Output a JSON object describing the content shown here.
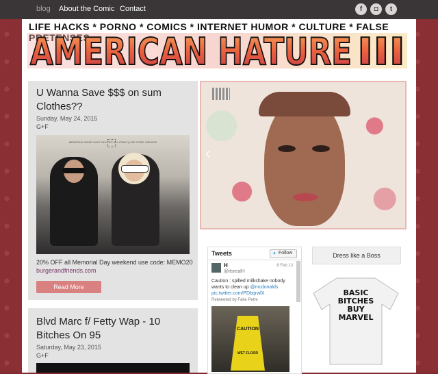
{
  "nav": {
    "blog": "blog",
    "about": "About the Comic",
    "contact": "Contact"
  },
  "social": {
    "facebook": "f",
    "instagram": "◘",
    "twitter": "t"
  },
  "header": {
    "tagline": "LIFE HACKS * PORNO * COMICS * INTERNET HUMOR * CULTURE * FALSE PRETENSES",
    "logo_text": "AMERICAN HATURE",
    "logo_suffix": "III"
  },
  "posts": [
    {
      "title_line1": "U Wanna Save $$$ on sum",
      "title_line2": "Clothes??",
      "date": "Sunday, May 24, 2015",
      "gplus": "G+F",
      "image_caption": "MEMORIAL WKND SALE 20% OFF ALL ITEMS | USE CODE: MEMO20",
      "body": "20% OFF all Memorial Day weekend use code: MEMO20",
      "link": "burgerandfriends.com",
      "readmore": "Read More"
    },
    {
      "title_line1": "Blvd Marc f/ Fetty Wap - 10",
      "title_line2": "Bitches On 95",
      "date": "Saturday, May 23, 2015",
      "gplus": "G+F"
    }
  ],
  "slider": {
    "prev": "‹"
  },
  "tweets": {
    "header": "Tweets",
    "follow": "Follow",
    "user": "H",
    "handle": "@itsrealH",
    "date": "8 Feb 13",
    "text_line1": "Caution : spilled milkshake nobody",
    "text_line2": "wants to clean up",
    "mention": "@mcdonalds",
    "link": "pic.twitter.com/PDbqrwlX",
    "retweet": "Retweeted by Fake Petre",
    "sign_line1": "CAUTION",
    "sign_line2": "WET FLOOR"
  },
  "sidebar": {
    "title": "Dress like a Boss",
    "shirt_line1": "BASIC",
    "shirt_line2": "BITCHES",
    "shirt_line3": "BUY",
    "shirt_line4": "MARVEL"
  }
}
